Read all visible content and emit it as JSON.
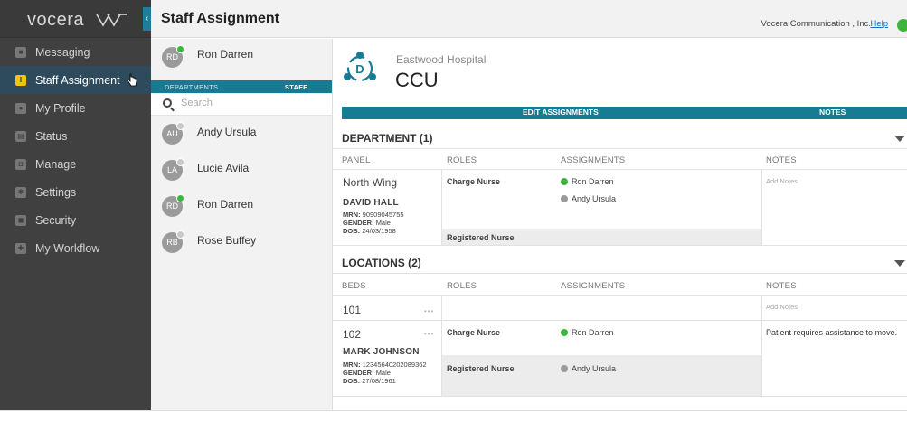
{
  "nav": {
    "brand": "vocera",
    "items": [
      {
        "label": "Messaging",
        "icon": "message-icon"
      },
      {
        "label": "Staff Assignment",
        "icon": "staff-icon",
        "active": true
      },
      {
        "label": "My Profile",
        "icon": "profile-icon"
      },
      {
        "label": "Status",
        "icon": "status-icon"
      },
      {
        "label": "Manage",
        "icon": "manage-icon"
      },
      {
        "label": "Settings",
        "icon": "settings-icon"
      },
      {
        "label": "Security",
        "icon": "security-icon"
      },
      {
        "label": "My Workflow",
        "icon": "workflow-icon"
      }
    ]
  },
  "header": {
    "title": "Staff Assignment",
    "company": "Vocera Communication , Inc.",
    "help": "Help",
    "status_color": "#3db53d"
  },
  "staff_panel": {
    "current_user": {
      "initials": "RD",
      "name": "Ron Darren",
      "status_color": "#3db53d"
    },
    "tabs": {
      "departments": "DEPARTMENTS",
      "staff": "STAFF"
    },
    "search_placeholder": "Search",
    "staff": [
      {
        "initials": "AU",
        "name": "Andy Ursula",
        "status_color": "#c8c8c8"
      },
      {
        "initials": "LA",
        "name": "Lucie Avila",
        "status_color": "#c8c8c8"
      },
      {
        "initials": "RD",
        "name": "Ron Darren",
        "status_color": "#3db53d"
      },
      {
        "initials": "RB",
        "name": "Rose Buffey",
        "status_color": "#c8c8c8"
      }
    ]
  },
  "main": {
    "hospital_icon_letter": "D",
    "hospital": "Eastwood Hospital",
    "department": "CCU",
    "actions": {
      "edit": "EDIT ASSIGNMENTS",
      "notes": "NOTES"
    },
    "department_section": {
      "title": "DEPARTMENT (1)",
      "columns": {
        "panel": "PANEL",
        "roles": "ROLES",
        "assignments": "ASSIGNMENTS",
        "notes": "NOTES"
      },
      "panel_name": "North Wing",
      "patient": {
        "name": "DAVID HALL",
        "mrn_label": "MRN:",
        "mrn": "90909045755",
        "gender_label": "GENDER:",
        "gender": "Male",
        "dob_label": "DOB:",
        "dob": "24/03/1958"
      },
      "roles": [
        "Charge Nurse",
        "Registered Nurse"
      ],
      "assignments": [
        {
          "name": "Ron Darren",
          "status_color": "#3db53d"
        },
        {
          "name": "Andy Ursula",
          "status_color": "#9a9a9a"
        }
      ],
      "notes_placeholder": "Add Notes"
    },
    "locations_section": {
      "title": "LOCATIONS (2)",
      "columns": {
        "beds": "BEDS",
        "roles": "ROLES",
        "assignments": "ASSIGNMENTS",
        "notes": "NOTES"
      },
      "beds": [
        {
          "bed": "101",
          "more": "•••",
          "notes_placeholder": "Add Notes"
        },
        {
          "bed": "102",
          "more": "•••",
          "patient": {
            "name": "MARK JOHNSON",
            "mrn_label": "MRN:",
            "mrn": "12345640202089362",
            "gender_label": "GENDER:",
            "gender": "Male",
            "dob_label": "DOB:",
            "dob": "27/08/1961"
          },
          "roles": [
            "Charge Nurse",
            "Registered Nurse"
          ],
          "assignments": [
            {
              "name": "Ron Darren",
              "status_color": "#3db53d"
            },
            {
              "name": "Andy Ursula",
              "status_color": "#9a9a9a"
            }
          ],
          "notes": "Patient requires assistance to move."
        }
      ]
    }
  }
}
